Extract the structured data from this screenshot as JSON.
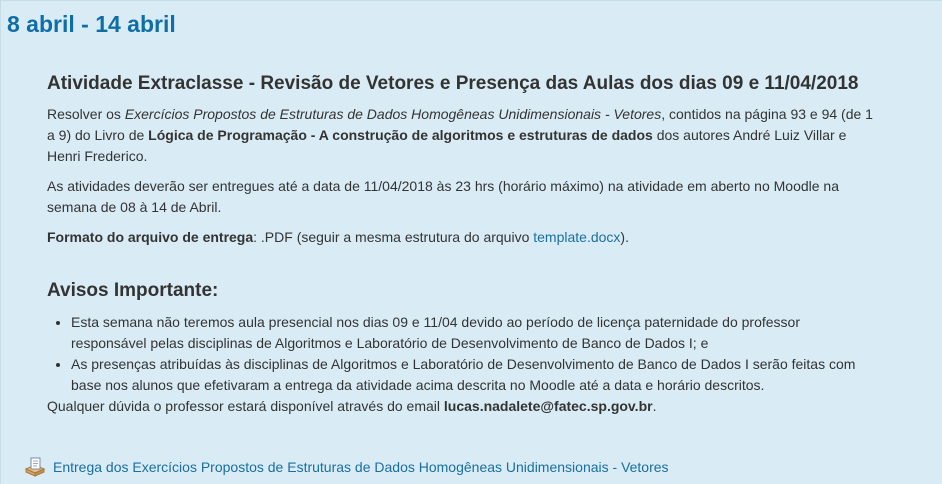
{
  "week": {
    "title": "8 abril - 14 abril"
  },
  "activity": {
    "title": "Atividade Extraclasse - Revisão de Vetores e Presença das Aulas dos dias 09 e 11/04/2018",
    "p1": {
      "pre": "Resolver os ",
      "em": "Exercícios Propostos de Estruturas de Dados Homogêneas Unidimensionais - Vetores",
      "mid": ", contidos na página 93 e 94 (de 1 a 9) do Livro de ",
      "book": "Lógica de Programação - A construção de algoritmos e estruturas de dados",
      "post": " dos autores André Luiz Villar e Henri Frederico."
    },
    "p2": "As atividades deverão ser entregues até a data de 11/04/2018 às 23 hrs (horário máximo) na atividade em aberto no Moodle na semana de 08 à 14 de Abril.",
    "p3": {
      "label": "Formato do arquivo de entrega",
      "text": ": .PDF (seguir a mesma estrutura do arquivo ",
      "link": "template.docx",
      "end": ")."
    }
  },
  "notices": {
    "title": "Avisos Importante:",
    "items": [
      "Esta semana não teremos aula presencial nos dias 09 e 11/04 devido ao período de licença paternidade do professor responsável pelas disciplinas de Algoritmos e Laboratório de Desenvolvimento de Banco de Dados I; e",
      "As presenças atribuídas às disciplinas de Algoritmos e Laboratório de Desenvolvimento de Banco de Dados I serão feitas com base nos alunos que efetivaram a entrega da atividade acima descrita no Moodle até a data e horário descritos."
    ],
    "contact_pre": "Qualquer dúvida o professor estará disponível através do email ",
    "contact_email": "lucas.nadalete@fatec.sp.gov.br",
    "contact_end": "."
  },
  "resource": {
    "icon": "assignment-icon",
    "label": "Entrega dos Exercícios Propostos de Estruturas de Dados Homogêneas Unidimensionais - Vetores"
  }
}
